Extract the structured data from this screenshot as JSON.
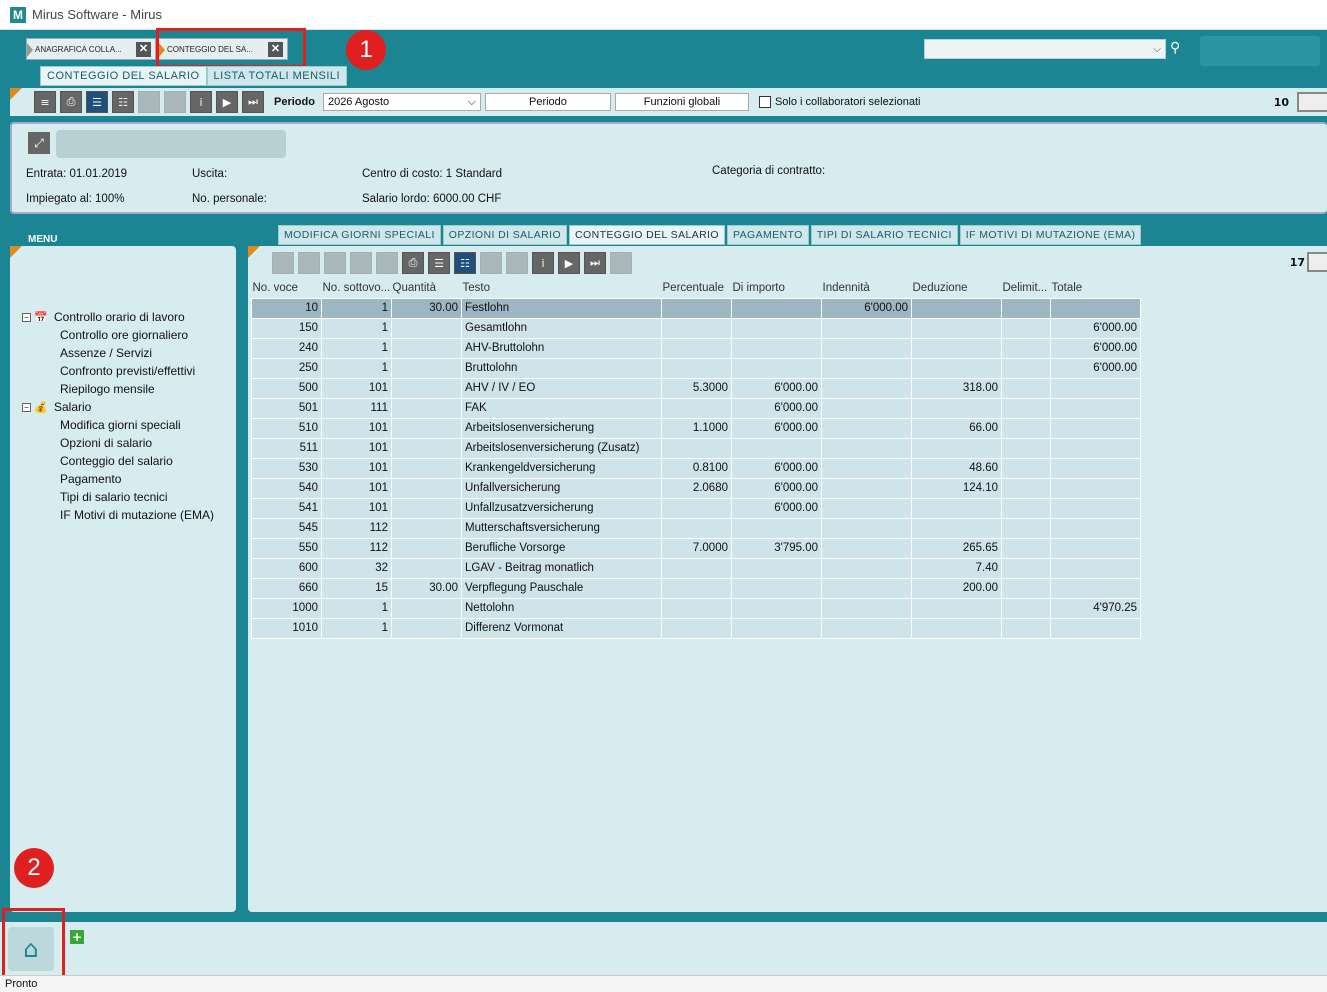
{
  "window": {
    "title": "Mirus Software - Mirus",
    "app_icon": "M"
  },
  "doc_tabs": [
    {
      "label": "ANAGRAFICA COLLA..."
    },
    {
      "label": "CONTEGGIO DEL SA..."
    }
  ],
  "markers": [
    "1",
    "2"
  ],
  "sub_tabs": [
    "CONTEGGIO DEL SALARIO",
    "LISTA TOTALI MENSILI"
  ],
  "toolbar": {
    "periodo_label": "Periodo",
    "periodo_value": "2026  Agosto",
    "periodo_button": "Periodo",
    "funzioni_button": "Funzioni globali",
    "checkbox_label": "Solo i collaboratori selezionati",
    "counter": "10"
  },
  "info": {
    "entrata": "Entrata: 01.01.2019",
    "uscita": "Uscita:",
    "centro": "Centro di costo: 1 Standard",
    "categoria": "Categoria di contratto:",
    "impiegato": "Impiegato al: 100%",
    "personale": "No. personale:",
    "salario": "Salario lordo: 6000.00 CHF"
  },
  "menu": {
    "title": "MENU",
    "groups": [
      {
        "label": "Controllo orario di lavoro",
        "items": [
          "Controllo ore giornaliero",
          "Assenze / Servizi",
          "Confronto previsti/effettivi",
          "Riepilogo mensile"
        ]
      },
      {
        "label": "Salario",
        "items": [
          "Modifica giorni speciali",
          "Opzioni di salario",
          "Conteggio del salario",
          "Pagamento",
          "Tipi di salario tecnici",
          "IF Motivi di mutazione (EMA)"
        ]
      }
    ]
  },
  "content_tabs": [
    "MODIFICA GIORNI SPECIALI",
    "OPZIONI DI SALARIO",
    "CONTEGGIO DEL SALARIO",
    "PAGAMENTO",
    "TIPI DI SALARIO TECNICI",
    "IF MOTIVI DI MUTAZIONE (EMA)"
  ],
  "content_counter": "17",
  "table": {
    "headers": [
      "No. voce",
      "No. sottovo...",
      "Quantità",
      "Testo",
      "Percentuale",
      "Di importo",
      "Indennità",
      "Deduzione",
      "Delimit...",
      "Totale"
    ],
    "rows": [
      [
        "10",
        "1",
        "30.00",
        "Festlohn",
        "",
        "",
        "6'000.00",
        "",
        "",
        ""
      ],
      [
        "150",
        "1",
        "",
        "Gesamtlohn",
        "",
        "",
        "",
        "",
        "",
        "6'000.00"
      ],
      [
        "240",
        "1",
        "",
        "AHV-Bruttolohn",
        "",
        "",
        "",
        "",
        "",
        "6'000.00"
      ],
      [
        "250",
        "1",
        "",
        "Bruttolohn",
        "",
        "",
        "",
        "",
        "",
        "6'000.00"
      ],
      [
        "500",
        "101",
        "",
        "AHV / IV / EO",
        "5.3000",
        "6'000.00",
        "",
        "318.00",
        "",
        ""
      ],
      [
        "501",
        "111",
        "",
        "FAK",
        "",
        "6'000.00",
        "",
        "",
        "",
        ""
      ],
      [
        "510",
        "101",
        "",
        "Arbeitslosenversicherung",
        "1.1000",
        "6'000.00",
        "",
        "66.00",
        "",
        ""
      ],
      [
        "511",
        "101",
        "",
        "Arbeitslosenversicherung (Zusatz)",
        "",
        "",
        "",
        "",
        "",
        ""
      ],
      [
        "530",
        "101",
        "",
        "Krankengeldversicherung",
        "0.8100",
        "6'000.00",
        "",
        "48.60",
        "",
        ""
      ],
      [
        "540",
        "101",
        "",
        "Unfallversicherung",
        "2.0680",
        "6'000.00",
        "",
        "124.10",
        "",
        ""
      ],
      [
        "541",
        "101",
        "",
        "Unfallzusatzversicherung",
        "",
        "6'000.00",
        "",
        "",
        "",
        ""
      ],
      [
        "545",
        "112",
        "",
        "Mutterschaftsversicherung",
        "",
        "",
        "",
        "",
        "",
        ""
      ],
      [
        "550",
        "112",
        "",
        "Berufliche Vorsorge",
        "7.0000",
        "3'795.00",
        "",
        "265.65",
        "",
        ""
      ],
      [
        "600",
        "32",
        "",
        "LGAV - Beitrag monatlich",
        "",
        "",
        "",
        "7.40",
        "",
        ""
      ],
      [
        "660",
        "15",
        "30.00",
        "Verpflegung Pauschale",
        "",
        "",
        "",
        "200.00",
        "",
        ""
      ],
      [
        "1000",
        "1",
        "",
        "Nettolohn",
        "",
        "",
        "",
        "",
        "",
        "4'970.25"
      ],
      [
        "1010",
        "1",
        "",
        "Differenz Vormonat",
        "",
        "",
        "",
        "",
        "",
        ""
      ]
    ]
  },
  "status": "Pronto"
}
